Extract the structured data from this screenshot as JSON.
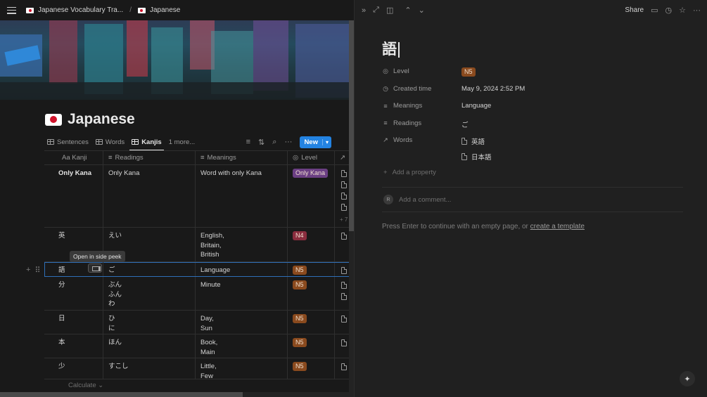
{
  "breadcrumb": {
    "parent": "Japanese Vocabulary Tra...",
    "separator": "/",
    "current": "Japanese"
  },
  "page": {
    "title": "Japanese"
  },
  "views": {
    "items": [
      {
        "label": "Sentences"
      },
      {
        "label": "Words"
      },
      {
        "label": "Kanjis"
      }
    ],
    "more": "1 more...",
    "new_label": "New"
  },
  "table": {
    "headers": {
      "kanji": "Aa Kanji",
      "readings": "Readings",
      "meanings": "Meanings",
      "level": "Level"
    },
    "rows": [
      {
        "kanji": "Only Kana",
        "readings": [
          "Only Kana"
        ],
        "meanings": [
          "Word with only Kana"
        ],
        "level": "Only Kana",
        "level_color": "#6b3f83",
        "docs": 4,
        "more": "+ 7"
      },
      {
        "kanji": "英",
        "readings": [
          "えい"
        ],
        "meanings": [
          "English,",
          "Britain,",
          "British"
        ],
        "level": "N4",
        "level_color": "#8a2d3e",
        "docs": 1
      },
      {
        "kanji": "語",
        "readings": [
          "ご"
        ],
        "meanings": [
          "Language"
        ],
        "level": "N5",
        "level_color": "#8a4a1e",
        "docs": 1
      },
      {
        "kanji": "分",
        "readings": [
          "ぶん",
          "ふん",
          "わ"
        ],
        "meanings": [
          "Minute"
        ],
        "level": "N5",
        "level_color": "#8a4a1e",
        "docs": 2
      },
      {
        "kanji": "日",
        "readings": [
          "ひ",
          "に"
        ],
        "meanings": [
          "Day,",
          "Sun"
        ],
        "level": "N5",
        "level_color": "#8a4a1e",
        "docs": 1
      },
      {
        "kanji": "本",
        "readings": [
          "ほん"
        ],
        "meanings": [
          "Book,",
          "Main"
        ],
        "level": "N5",
        "level_color": "#8a4a1e",
        "docs": 1
      },
      {
        "kanji": "少",
        "readings": [
          "すこし"
        ],
        "meanings": [
          "Little,",
          "Few"
        ],
        "level": "N5",
        "level_color": "#8a4a1e",
        "docs": 1
      }
    ],
    "tooltip": "Open in side peek",
    "calculate": "Calculate"
  },
  "peek": {
    "share": "Share",
    "title": "語",
    "properties": {
      "level_name": "Level",
      "level_value": "N5",
      "created_name": "Created time",
      "created_value": "May 9, 2024 2:52 PM",
      "meanings_name": "Meanings",
      "meanings_value": "Language",
      "readings_name": "Readings",
      "readings_value": "ご",
      "words_name": "Words",
      "words_values": [
        "英語",
        "日本語"
      ]
    },
    "add_property": "Add a property",
    "avatar_letter": "R",
    "comment_placeholder": "Add a comment...",
    "hint_text": "Press Enter to continue with an empty page, or ",
    "hint_link": "create a template"
  }
}
